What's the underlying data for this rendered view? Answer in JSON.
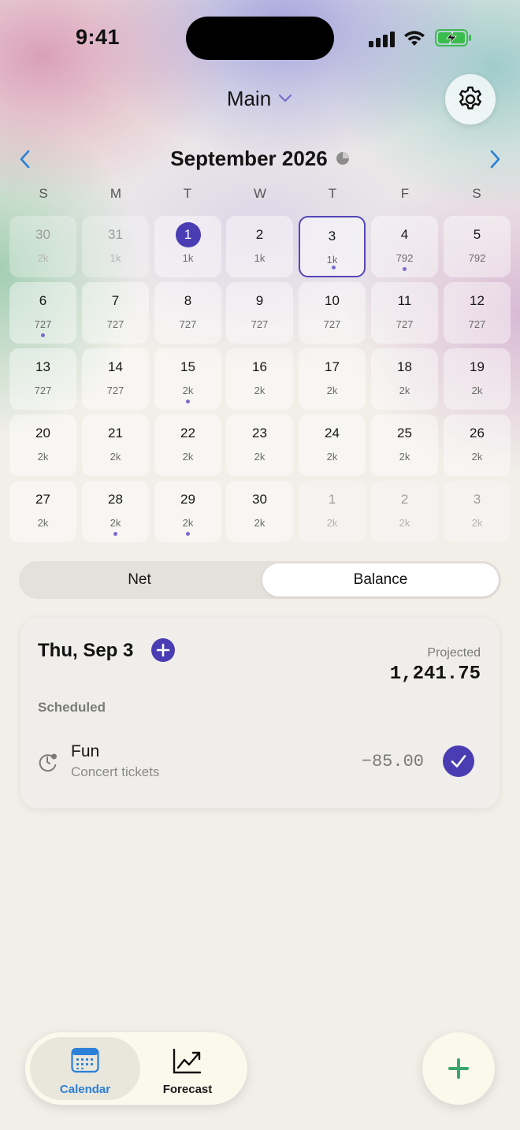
{
  "status_bar": {
    "time": "9:41"
  },
  "header": {
    "account": "Main",
    "month_title": "September 2026"
  },
  "weekdays": [
    "S",
    "M",
    "T",
    "W",
    "T",
    "F",
    "S"
  ],
  "calendar": [
    {
      "day": "30",
      "value": "2k",
      "dim": true
    },
    {
      "day": "31",
      "value": "1k",
      "dim": true
    },
    {
      "day": "1",
      "value": "1k",
      "today": true
    },
    {
      "day": "2",
      "value": "1k"
    },
    {
      "day": "3",
      "value": "1k",
      "selected": true,
      "dot": true
    },
    {
      "day": "4",
      "value": "792",
      "dot": true
    },
    {
      "day": "5",
      "value": "792"
    },
    {
      "day": "6",
      "value": "727",
      "dot": true
    },
    {
      "day": "7",
      "value": "727"
    },
    {
      "day": "8",
      "value": "727"
    },
    {
      "day": "9",
      "value": "727"
    },
    {
      "day": "10",
      "value": "727"
    },
    {
      "day": "11",
      "value": "727"
    },
    {
      "day": "12",
      "value": "727"
    },
    {
      "day": "13",
      "value": "727"
    },
    {
      "day": "14",
      "value": "727"
    },
    {
      "day": "15",
      "value": "2k",
      "dot": true
    },
    {
      "day": "16",
      "value": "2k"
    },
    {
      "day": "17",
      "value": "2k"
    },
    {
      "day": "18",
      "value": "2k"
    },
    {
      "day": "19",
      "value": "2k"
    },
    {
      "day": "20",
      "value": "2k"
    },
    {
      "day": "21",
      "value": "2k"
    },
    {
      "day": "22",
      "value": "2k"
    },
    {
      "day": "23",
      "value": "2k"
    },
    {
      "day": "24",
      "value": "2k"
    },
    {
      "day": "25",
      "value": "2k"
    },
    {
      "day": "26",
      "value": "2k"
    },
    {
      "day": "27",
      "value": "2k"
    },
    {
      "day": "28",
      "value": "2k",
      "dot": true
    },
    {
      "day": "29",
      "value": "2k",
      "dot": true
    },
    {
      "day": "30",
      "value": "2k"
    },
    {
      "day": "1",
      "value": "2k",
      "dim": true
    },
    {
      "day": "2",
      "value": "2k",
      "dim": true
    },
    {
      "day": "3",
      "value": "2k",
      "dim": true
    }
  ],
  "segmented": {
    "net_label": "Net",
    "balance_label": "Balance",
    "selected": "Balance"
  },
  "day_card": {
    "date": "Thu, Sep 3",
    "projected_label": "Projected",
    "projected_value": "1,241.75",
    "section_label": "Scheduled",
    "transactions": [
      {
        "category": "Fun",
        "description": "Concert tickets",
        "amount": "−85.00",
        "icon": "scheduled-clock-icon",
        "checked": true
      }
    ]
  },
  "tab_bar": {
    "calendar_label": "Calendar",
    "forecast_label": "Forecast",
    "active": "Calendar"
  },
  "colors": {
    "accent": "#4a3db3",
    "link_blue": "#2a7fd8",
    "fab_plus": "#3aa76d"
  }
}
